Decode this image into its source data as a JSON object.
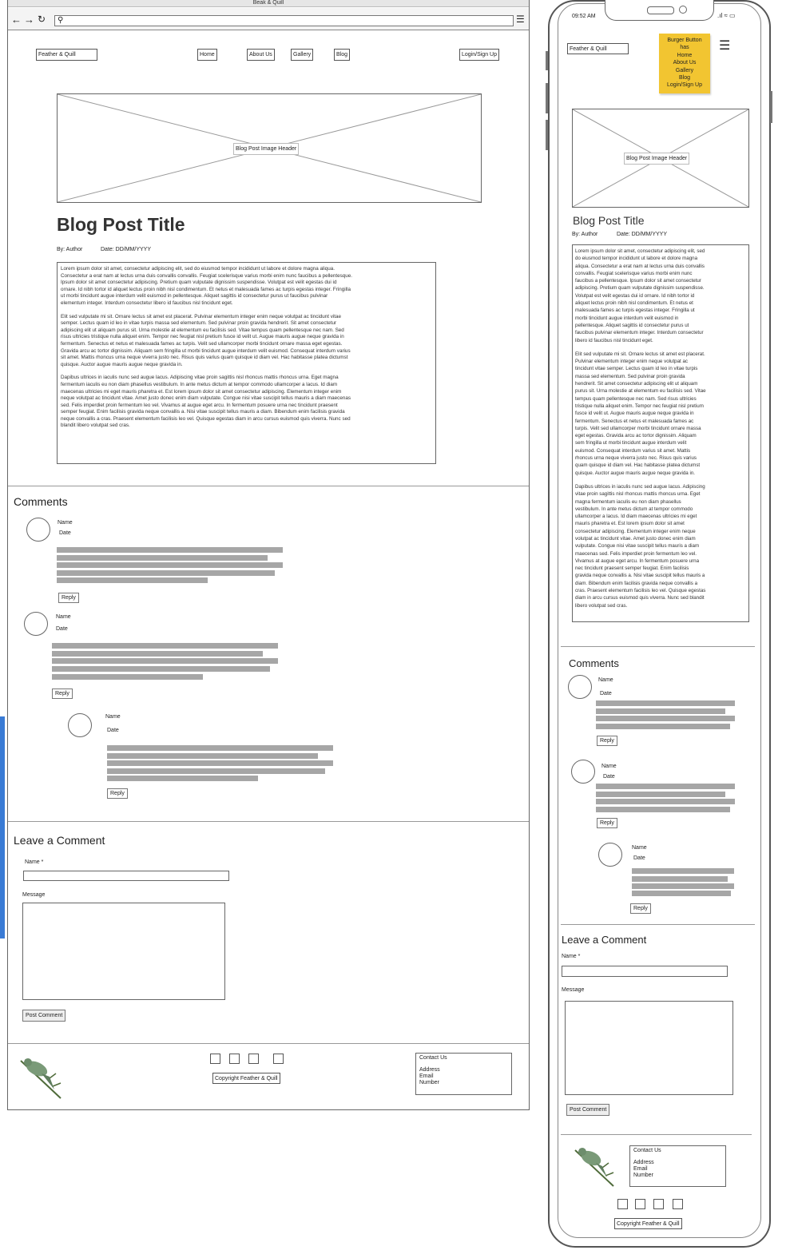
{
  "browser": {
    "window_title": "Beak & Quill",
    "back_icon": "arrow-left-icon",
    "forward_icon": "arrow-right-icon",
    "reload_icon": "reload-icon",
    "search_icon": "magnifier-icon",
    "menu_icon": "hamburger-icon"
  },
  "nav": {
    "logo": "Feather & Quill",
    "links": [
      "Home",
      "About Us",
      "Gallery",
      "Blog"
    ],
    "login": "Login/Sign Up"
  },
  "post": {
    "image_label": "Blog Post Image Header",
    "title": "Blog Post Title",
    "author": "By: Author",
    "date": "Date: DD/MM/YYYY",
    "desktop_paragraphs": [
      "Lorem ipsum dolor sit amet, consectetur adipiscing elit, sed do eiusmod tempor incididunt ut labore et dolore magna aliqua.\nConsectetur a erat nam at lectus urna duis convallis convallis. Feugiat scelerisque varius morbi enim nunc faucibus a pellentesque.\nIpsum dolor sit amet consectetur adipiscing. Pretium quam vulputate dignissim suspendisse. Volutpat est velit egestas dui id\nornare. Id nibh tortor id aliquet lectus proin nibh nisl condimentum. Et netus et malesuada fames ac turpis egestas integer. Fringilla\nut morbi tincidunt augue interdum velit euismod in pellentesque. Aliquet sagittis id consectetur purus ut faucibus pulvinar\nelementum integer. Interdum consectetur libero id faucibus nisl tincidunt eget.",
      "Elit sed vulputate mi sit. Ornare lectus sit amet est placerat. Pulvinar elementum integer enim neque volutpat ac tincidunt vitae\nsemper. Lectus quam id leo in vitae turpis massa sed elementum. Sed pulvinar proin gravida hendrerit. Sit amet consectetur\nadipiscing elit ut aliquam purus sit. Urna molestie at elementum eu facilisis sed. Vitae tempus quam pellentesque nec nam. Sed\nrisus ultricies tristique nulla aliquet enim. Tempor nec feugiat nisl pretium fusce id velit ut. Augue mauris augue neque gravida in\nfermentum. Senectus et netus et malesuada fames ac turpis. Velit sed ullamcorper morbi tincidunt ornare massa eget egestas.\nGravida arcu ac tortor dignissim. Aliquam sem fringilla ut morbi tincidunt augue interdum velit euismod. Consequat interdum varius\nsit amet. Mattis rhoncus urna neque viverra justo nec. Risus quis varius quam quisque id diam vel. Hac habitasse platea dictumst\nquisque. Auctor augue mauris augue neque gravida in.",
      "Dapibus ultrices in iaculis nunc sed augue lacus. Adipiscing vitae proin sagittis nisl rhoncus mattis rhoncus urna. Eget magna\nfermentum iaculis eu non diam phasellus vestibulum. In ante metus dictum at tempor commodo ullamcorper a lacus. Id diam\nmaecenas ultricies mi eget mauris pharetra et. Est lorem ipsum dolor sit amet consectetur adipiscing. Elementum integer enim\nneque volutpat ac tincidunt vitae. Amet justo donec enim diam vulputate. Congue nisi vitae suscipit tellus mauris a diam maecenas\nsed. Felis imperdiet proin fermentum leo vel. Vivamus at augue eget arcu. In fermentum posuere urna nec tincidunt praesent\nsemper feugiat. Enim facilisis gravida neque convallis a. Nisi vitae suscipit tellus mauris a diam. Bibendum enim facilisis gravida\nneque convallis a cras. Praesent elementum facilisis leo vel. Quisque egestas diam in arcu cursus euismod quis viverra. Nunc sed\nblandit libero volutpat sed cras."
    ],
    "mobile_paragraphs": [
      "Lorem ipsum dolor sit amet, consectetur adipiscing elit, sed\ndo eiusmod tempor incididunt ut labore et dolore magna\naliqua. Consectetur a erat nam at lectus urna duis convallis\nconvallis. Feugiat scelerisque varius morbi enim nunc\nfaucibus a pellentesque. Ipsum dolor sit amet consectetur\nadipiscing. Pretium quam vulputate dignissim suspendisse.\nVolutpat est velit egestas dui id ornare. Id nibh tortor id\naliquet lectus proin nibh nisl condimentum. Et netus et\nmalesuada fames ac turpis egestas integer. Fringilla ut\nmorbi tincidunt augue interdum velit euismod in\npellentesque. Aliquet sagittis id consectetur purus ut\nfaucibus pulvinar elementum integer. Interdum consectetur\nlibero id faucibus nisl tincidunt eget.",
      "Elit sed vulputate mi sit. Ornare lectus sit amet est placerat.\nPulvinar elementum integer enim neque volutpat ac\ntincidunt vitae semper. Lectus quam id leo in vitae turpis\nmassa sed elementum. Sed pulvinar proin gravida\nhendrerit. Sit amet consectetur adipiscing elit ut aliquam\npurus sit. Urna molestie at elementum eu facilisis sed. Vitae\ntempus quam pellentesque nec nam. Sed risus ultricies\ntristique nulla aliquet enim. Tempor nec feugiat nisl pretium\nfusce id velit ut. Augue mauris augue neque gravida in\nfermentum. Senectus et netus et malesuada fames ac\nturpis. Velit sed ullamcorper morbi tincidunt ornare massa\neget egestas. Gravida arcu ac tortor dignissim. Aliquam\nsem fringilla ut morbi tincidunt augue interdum velit\neuismod. Consequat interdum varius sit amet. Mattis\nrhoncus urna neque viverra justo nec. Risus quis varius\nquam quisque id diam vel. Hac habitasse platea dictumst\nquisque. Auctor augue mauris augue neque gravida in.",
      "Dapibus ultrices in iaculis nunc sed augue lacus. Adipiscing\nvitae proin sagittis nisl rhoncus mattis rhoncus urna. Eget\nmagna fermentum iaculis eu non diam phasellus\nvestibulum. In ante metus dictum at tempor commodo\nullamcorper a lacus. Id diam maecenas ultricies mi eget\nmauris pharetra et. Est lorem ipsum dolor sit amet\nconsectetur adipiscing. Elementum integer enim neque\nvolutpat ac tincidunt vitae. Amet justo donec enim diam\nvulputate. Congue nisi vitae suscipit tellus mauris a diam\nmaecenas sed. Felis imperdiet proin fermentum leo vel.\nVivamus at augue eget arcu. In fermentum posuere urna\nnec tincidunt praesent semper feugiat. Enim facilisis\ngravida neque convallis a. Nisi vitae suscipit tellus mauris a\ndiam. Bibendum enim facilisis gravida neque convallis a\ncras. Praesent elementum facilisis leo vel. Quisque egestas\ndiam in arcu cursus euismod quis viverra. Nunc sed blandit\nlibero volutpat sed cras."
    ]
  },
  "comments": {
    "heading": "Comments",
    "name_label": "Name",
    "date_label": "Date",
    "reply_label": "Reply"
  },
  "leave_comment": {
    "heading": "Leave a Comment",
    "name_label": "Name *",
    "message_label": "Message",
    "submit_label": "Post Comment"
  },
  "footer": {
    "logo_icon": "bird-on-branch-icon",
    "social_icons": [
      "social-icon-1",
      "social-icon-2",
      "social-icon-3",
      "social-icon-4"
    ],
    "copyright": "Copyright Feather & Quill",
    "contact_heading": "Contact Us",
    "contact_lines": [
      "Address",
      "Email",
      "Number"
    ]
  },
  "mobile": {
    "time": "09:52 AM",
    "status_icons": "signal-wifi-battery-icon",
    "sticky_note": "Burger Button\nhas\nHome\nAbout Us\nGallery\nBlog\nLogin/Sign Up",
    "burger_icon": "hamburger-icon",
    "accent_note_color": "#f2c531"
  }
}
